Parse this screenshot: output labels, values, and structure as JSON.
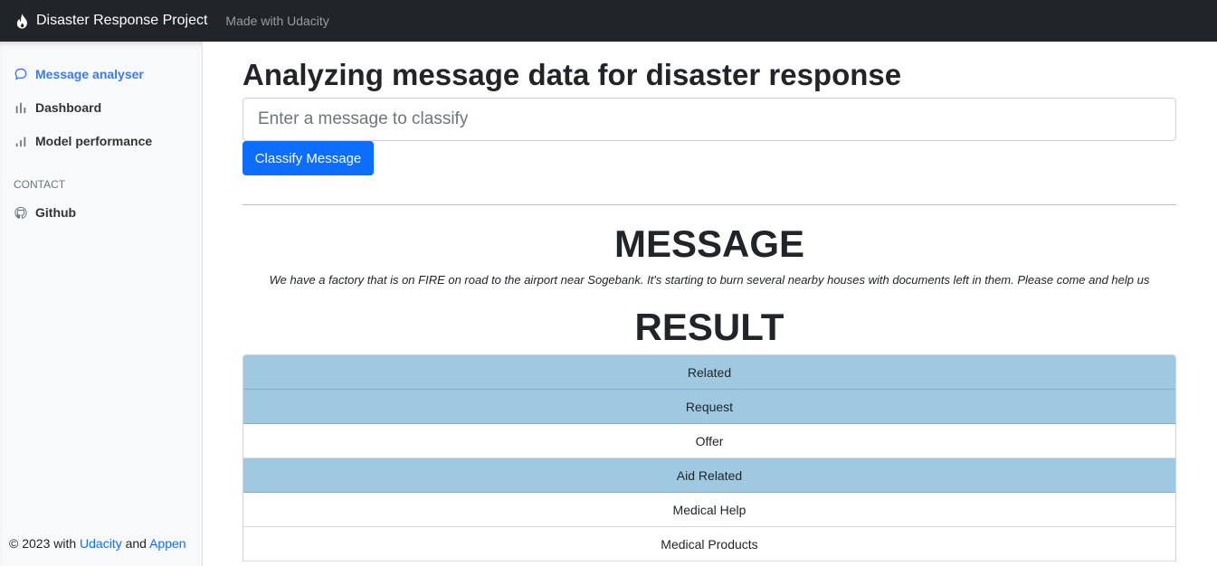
{
  "navbar": {
    "brand": "Disaster Response Project",
    "link": "Made with Udacity"
  },
  "sidebar": {
    "items": [
      {
        "label": "Message analyser",
        "icon": "chat-icon",
        "active": true
      },
      {
        "label": "Dashboard",
        "icon": "bar-chart-icon",
        "active": false
      },
      {
        "label": "Model performance",
        "icon": "bar-chart-ascending-icon",
        "active": false
      }
    ],
    "contact_heading": "CONTACT",
    "contact_items": [
      {
        "label": "Github",
        "icon": "github-icon"
      }
    ],
    "footer": {
      "prefix": "© 2023 with ",
      "link1": "Udacity",
      "middle": " and ",
      "link2": "Appen"
    }
  },
  "main": {
    "title": "Analyzing message data for disaster response",
    "input_placeholder": "Enter a message to classify",
    "button_label": "Classify Message",
    "message_heading": "MESSAGE",
    "message_text": "We have a factory that is on FIRE on road to the airport near Sogebank. It's starting to burn several nearby houses with documents left in them. Please come and help us",
    "result_heading": "RESULT",
    "results": [
      {
        "label": "Related",
        "positive": true
      },
      {
        "label": "Request",
        "positive": true
      },
      {
        "label": "Offer",
        "positive": false
      },
      {
        "label": "Aid Related",
        "positive": true
      },
      {
        "label": "Medical Help",
        "positive": false
      },
      {
        "label": "Medical Products",
        "positive": false
      }
    ]
  },
  "colors": {
    "navbar": "#212529",
    "accent": "#0d6efd",
    "active_link": "#3d7be6",
    "positive_row": "#9ec9e0"
  }
}
